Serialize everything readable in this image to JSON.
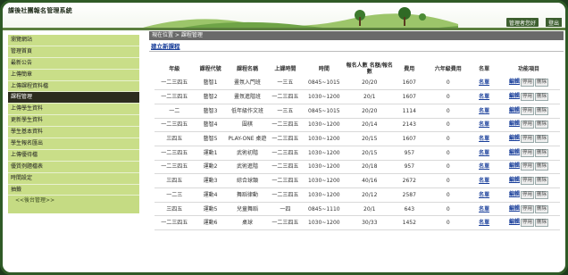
{
  "header": {
    "title": "課後社團報名管理系統",
    "admin": "管理者您好",
    "logout": "登出"
  },
  "sidebar": {
    "items": [
      {
        "label": "瀏覽網站"
      },
      {
        "label": "管理首頁"
      },
      {
        "label": "最新公告"
      },
      {
        "label": "上傳簡章"
      },
      {
        "label": "上傳課程資料檔"
      },
      {
        "label": "課程管理"
      },
      {
        "label": "上傳學生資料"
      },
      {
        "label": "更新學生資料"
      },
      {
        "label": "學生基本資料"
      },
      {
        "label": "學生報名匯出"
      },
      {
        "label": "上傳優待檔"
      },
      {
        "label": "優質例題檔表"
      },
      {
        "label": "時間設定"
      },
      {
        "label": "抽籤"
      }
    ],
    "active_index": 5,
    "footer": "<<後台管理>>"
  },
  "content": {
    "breadcrumb": "現在位置 > 課程管理",
    "add_course": "建立新課程"
  },
  "table": {
    "headers": [
      "年級",
      "課程代號",
      "課程名稱",
      "上課時間",
      "時間",
      "報名人數 名額/報名數",
      "費用",
      "六年級費用",
      "名單",
      "功能項目"
    ],
    "rows": [
      [
        "一二三四五",
        "藝智1",
        "畫氛入門班",
        "一三五",
        "0845~1015",
        "20/20",
        "1607",
        "0"
      ],
      [
        "一二三四五",
        "藝智2",
        "畫氛進階班",
        "一二三四五",
        "1030~1200",
        "20/1",
        "1607",
        "0"
      ],
      [
        "一二",
        "藝智3",
        "低年級作文班",
        "一三五",
        "0845~1015",
        "20/20",
        "1114",
        "0"
      ],
      [
        "一二三四五",
        "藝智4",
        "圍棋",
        "一二三四五",
        "1030~1200",
        "20/14",
        "2143",
        "0"
      ],
      [
        "三四五",
        "藝智5",
        "PLAY-ONE 桌遊",
        "一二三四五",
        "1030~1200",
        "20/15",
        "1607",
        "0"
      ],
      [
        "一二三四五",
        "運動1",
        "武術初階",
        "一二三四五",
        "1030~1200",
        "20/15",
        "957",
        "0"
      ],
      [
        "一二三四五",
        "運動2",
        "武術進階",
        "一二三四五",
        "1030~1200",
        "20/18",
        "957",
        "0"
      ],
      [
        "三四五",
        "運動3",
        "綜合球類",
        "一二三四五",
        "1030~1200",
        "40/16",
        "2672",
        "0"
      ],
      [
        "一二三",
        "運動4",
        "舞蹈律動",
        "一二三四五",
        "1030~1200",
        "20/12",
        "2587",
        "0"
      ],
      [
        "三四五",
        "運動5",
        "兒童舞蹈",
        "一四",
        "0845~1110",
        "20/1",
        "643",
        "0"
      ],
      [
        "一二三四五",
        "運動6",
        "桌球",
        "一二三四五",
        "1030~1200",
        "30/33",
        "1452",
        "0"
      ]
    ],
    "list_label": "名單",
    "edit_label": "編輯",
    "stop_label": "停用",
    "delete_label": "刪除"
  }
}
